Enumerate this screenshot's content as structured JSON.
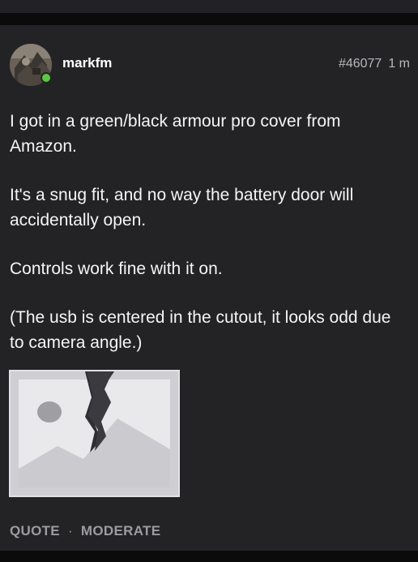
{
  "post": {
    "author": "markfm",
    "author_online": true,
    "post_number": "#46077",
    "time_ago": "1 m",
    "paragraphs": [
      "I got in a green/black armour pro cover from Amazon.",
      "It's a snug fit, and no way the battery door will accidentally open.",
      "Controls work fine with it on.",
      "(The usb is centered in the cutout, it looks odd due to camera angle.)"
    ],
    "attachment": {
      "icon": "broken-image-icon"
    }
  },
  "actions": {
    "quote_label": "QUOTE",
    "separator": "·",
    "moderate_label": "MODERATE"
  },
  "colors": {
    "background": "#1f1f22",
    "post_background": "#232326",
    "online_indicator": "#5cc83f",
    "action_text": "#9c9ca0"
  }
}
